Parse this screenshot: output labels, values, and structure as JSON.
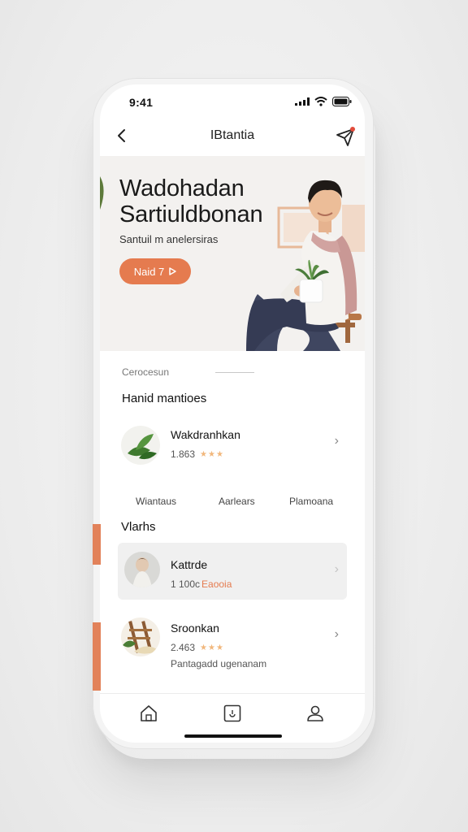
{
  "status": {
    "time": "9:41"
  },
  "nav": {
    "title": "IBtantia"
  },
  "hero": {
    "title_line1": "Wadohadan",
    "title_line2": "Sartiuldbonan",
    "subtitle": "Santuil m anelersiras",
    "button_label": "Naid 7",
    "colors": {
      "accent": "#e57b4f"
    }
  },
  "section": {
    "caption": "Cerocesun",
    "heading": "Hanid mantioes"
  },
  "featured": {
    "title": "Wakdranhkan",
    "count": "1.863",
    "stars": "★★★",
    "icon": "plant-leaf-icon"
  },
  "tabs": [
    "Wiantaus",
    "Aarlears",
    "Plamoana"
  ],
  "lists": {
    "heading": "Vlarhs"
  },
  "items": [
    {
      "title": "Kattrde",
      "count": "1 100c",
      "tag": "Eaooia"
    },
    {
      "title": "Sroonkan",
      "count": "2.463",
      "stars": "★★★"
    }
  ],
  "note": "Pantagadd ugenanam",
  "tabbar": [
    "home-icon",
    "box-icon",
    "profile-icon"
  ]
}
